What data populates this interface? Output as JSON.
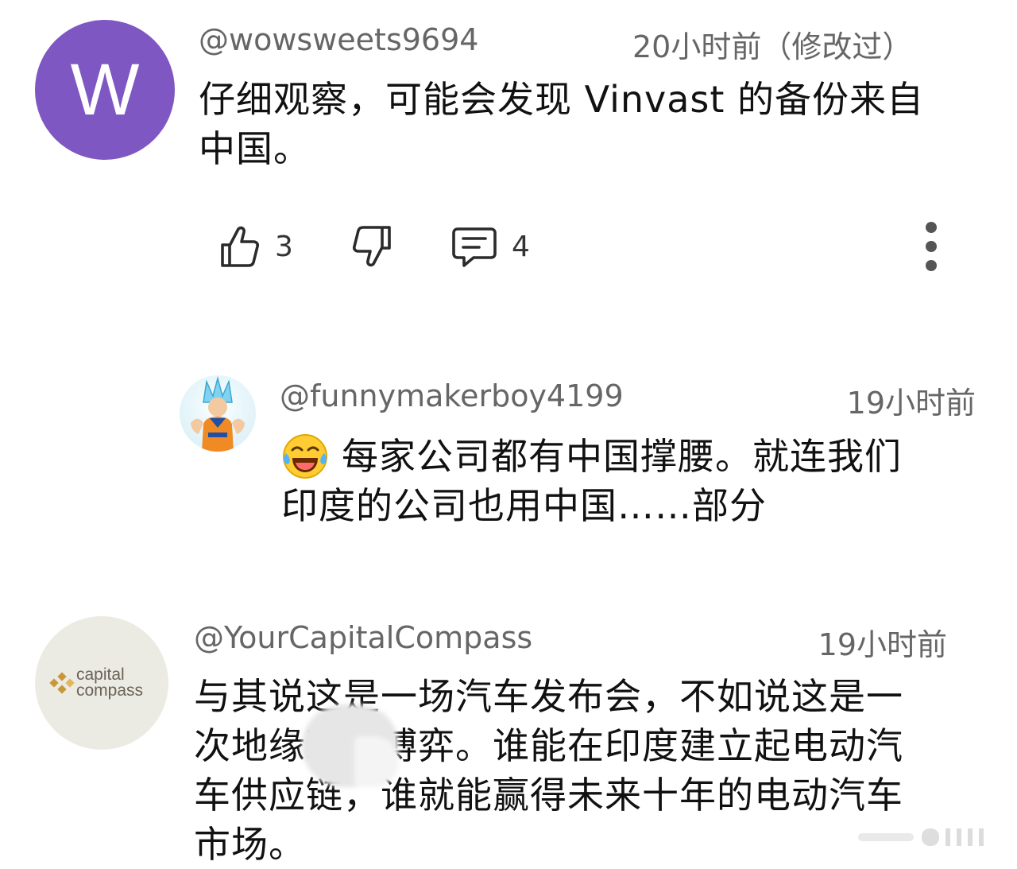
{
  "comments": [
    {
      "avatar_letter": "W",
      "avatar_color": "#7e57c2",
      "handle": "@wowsweets9694",
      "time": "20小时前（修改过）",
      "line1": "仔细观察，可能会发现 Vinvast 的备份来自",
      "line2": "中国。",
      "likes": "3",
      "replies": "4"
    },
    {
      "avatar_icon": "anime-character-avatar",
      "handle": "@funnymakerboy4199",
      "time": "19小时前",
      "line1": "每家公司都有中国撑腰。就连我们",
      "line2": "印度的公司也用中国……部分"
    },
    {
      "avatar_logo_line1": "capital",
      "avatar_logo_line2": "compass",
      "handle": "@YourCapitalCompass",
      "time": "19小时前",
      "line1": "与其说这是一场汽车发布会，不如说这是一",
      "line2": "次地缘政治博弈。谁能在印度建立起电动汽",
      "line3": "车供应链，谁就能赢得未来十年的电动汽车",
      "line4": "市场。"
    }
  ],
  "icons": {
    "like": "thumbs-up-icon",
    "dislike": "thumbs-down-icon",
    "reply": "comment-icon",
    "more": "more-vert-icon",
    "emoji": "tears-of-joy-emoji"
  }
}
